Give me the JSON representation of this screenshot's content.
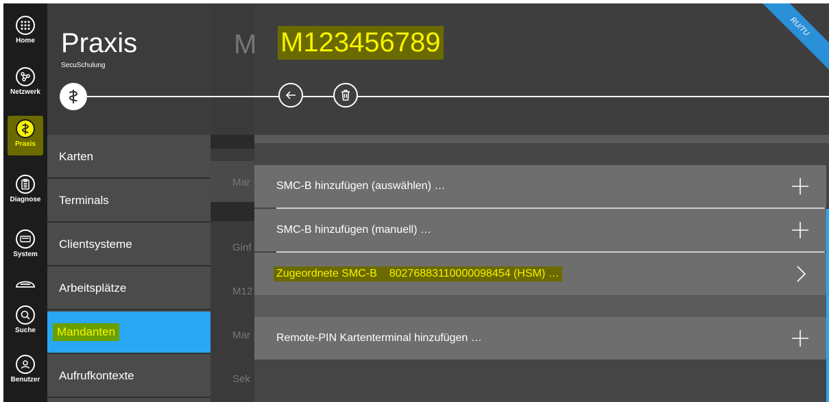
{
  "rail": [
    {
      "label": "Home",
      "icon": "grid-icon"
    },
    {
      "label": "Netzwerk",
      "icon": "network-icon"
    },
    {
      "label": "Praxis",
      "icon": "caduceus-icon"
    },
    {
      "label": "Diagnose",
      "icon": "clipboard-icon"
    },
    {
      "label": "System",
      "icon": "keyboard-icon"
    },
    {
      "label": "",
      "icon": "card-terminal-icon"
    },
    {
      "label": "Suche",
      "icon": "search-icon"
    },
    {
      "label": "Benutzer",
      "icon": "user-icon"
    }
  ],
  "praxis": {
    "title": "Praxis",
    "subtitle": "SecuSchulung",
    "menu": [
      "Karten",
      "Terminals",
      "Clientsysteme",
      "Arbeitsplätze",
      "Mandanten",
      "Aufrufkontexte"
    ],
    "active": "Mandanten"
  },
  "middle": {
    "title": "M",
    "texts": [
      "Mar",
      "Ginf",
      "M12",
      "Mar",
      "Sek"
    ]
  },
  "main": {
    "title": "M123456789",
    "ribbon": "RU/TU",
    "rows": [
      {
        "label": "SMC-B hinzufügen (auswählen) …",
        "action": "plus-icon"
      },
      {
        "label": "SMC-B hinzufügen (manuell) …",
        "action": "plus-icon"
      },
      {
        "label": "Zugeordnete SMC-B",
        "value": "80276883110000098454 (HSM) …",
        "action": "chevron-right-icon"
      },
      {
        "label": "Remote-PIN Kartenterminal hinzufügen …",
        "action": "plus-icon"
      }
    ]
  },
  "colors": {
    "accent": "#2aa8f4",
    "highlight": "#f7f300",
    "highlight_bg": "#6a6a00"
  }
}
